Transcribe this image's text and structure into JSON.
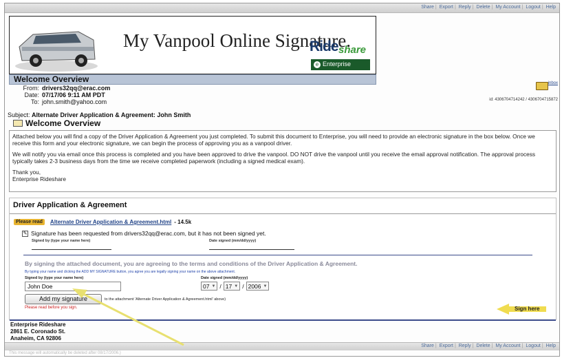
{
  "toolbar": {
    "links": [
      "Share",
      "Export",
      "Reply",
      "Delete",
      "My Account",
      "Logout",
      "Help"
    ]
  },
  "banner": {
    "title": "My Vanpool Online Signature.",
    "logo_ride": "Ride",
    "logo_share": "share",
    "logo_enterprise": "Enterprise",
    "logo_enterprise_sub": "RENT-A-CAR"
  },
  "welcome": {
    "header": "Welcome Overview",
    "subtitle": "Welcome Overview"
  },
  "meta": {
    "from_label": "From:",
    "from": "drivers32qq@erac.com",
    "date_label": "Date:",
    "date": "07/17/06 9:11 AM PDT",
    "to_label": "To:",
    "to": "john.smith@yahoo.com",
    "subject_label": "Subject:",
    "subject": "Alternate Driver Application & Agreement: John Smith"
  },
  "folder": {
    "link": "inbox",
    "id_text": "id: 4306704714242 / 4306704715872"
  },
  "message": {
    "p1": "Attached below you will find a copy of the Driver Application & Agreement you just completed.  To submit this document to Enterprise, you will need to provide an electronic signature in the box below.  Once we receive this form and your electronic signature, we can begin the process of approving you as a vanpool driver.",
    "p2": "We will notify you via email once this process is completed and you have been approved to drive the vanpool.  DO NOT drive the vanpool until you receive the email approval notification.  The approval process typically takes 2-3 business days from the time we receive completed paperwork (including a signed medical exam).",
    "p3a": "Thank you,",
    "p3b": "Enterprise Rideshare"
  },
  "agreement": {
    "title": "Driver Application & Agreement",
    "please_read": "Please read",
    "doc_link": "Alternate Driver Application & Agreement.html",
    "doc_size": "- 14.5k",
    "sig_requested": "Signature has been requested from drivers32qq@erac.com, but it has not been signed yet.",
    "signed_by_label": "Signed by (type your name here)",
    "date_signed_label": "Date signed (mm/dd/yyyy)",
    "by_signing": "By signing the attached document, you are agreeing to the terms and conditions of the Driver Application & Agreement.",
    "by_typing": "By typing your name and clicking the ADD MY SIGNATURE button, you agree you are legally signing your name on the above attachment.",
    "form_signed_by_label": "Signed by (type your name here)",
    "form_date_label": "Date signed (mm/dd/yyyy)",
    "name_value": "John Doe",
    "month": "07",
    "day": "17",
    "year": "2006",
    "add_button": "Add my signature",
    "attach_text": "to the attachment 'Alternate Driver Application & Agreement.html' above)",
    "read_first": "Please read before you sign.",
    "sign_here": "Sign here"
  },
  "address": {
    "line1": "Enterprise Rideshare",
    "line2": "2861 E. Coronado St.",
    "line3": "Anaheim, CA 92806"
  },
  "footnote": "This message will automatically be deleted after 08/17/2006.)",
  "colors": {
    "header_bg": "#b8c4d6",
    "link": "#224488",
    "badge": "#e8b430",
    "arrow": "#e8e070",
    "rule": "#3a4a8a"
  }
}
